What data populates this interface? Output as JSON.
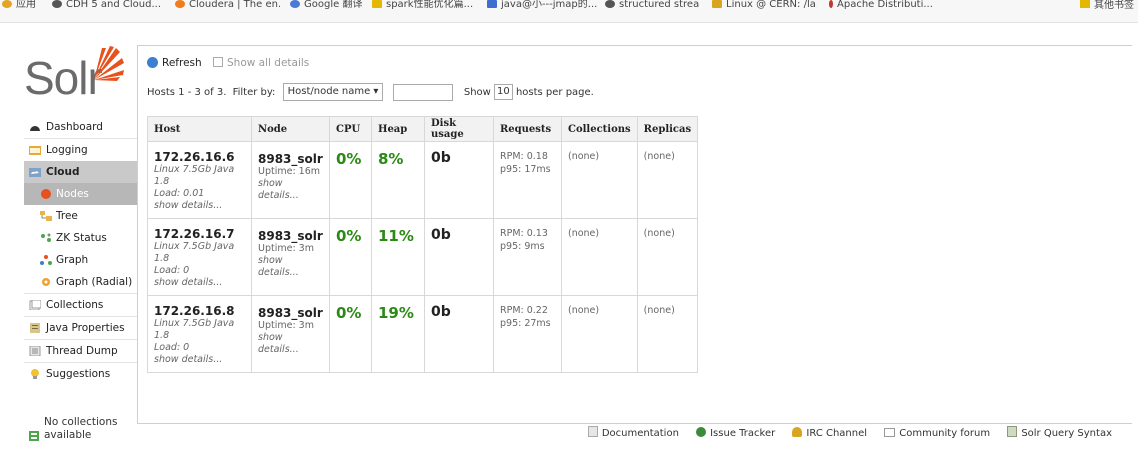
{
  "bookmarks": [
    {
      "label": "应用",
      "color": "#e4a524"
    },
    {
      "label": "CDH 5 and Cloud...",
      "color": "#555555"
    },
    {
      "label": "Cloudera | The en...",
      "color": "#f07c1c"
    },
    {
      "label": "Google 翻译",
      "color": "#4a7ad8"
    },
    {
      "label": "spark性能优化篇...",
      "color": "#e4b700"
    },
    {
      "label": "java@小---jmap的...",
      "color": "#3b6fd0"
    },
    {
      "label": "structured strea...",
      "color": "#555555"
    },
    {
      "label": "Linux @ CERN: /la...",
      "color": "#d9a520"
    },
    {
      "label": "Apache Distributi...",
      "color": "#c0392b"
    }
  ],
  "bookmarks_right": "其他书签",
  "logo_text": "Solr",
  "sidebar": {
    "items": [
      {
        "label": "Dashboard",
        "icon": "dashboard-icon"
      },
      {
        "label": "Logging",
        "icon": "logging-icon"
      },
      {
        "label": "Cloud",
        "icon": "cloud-icon"
      },
      {
        "label": "Nodes",
        "icon": "nodes-icon"
      },
      {
        "label": "Tree",
        "icon": "tree-icon"
      },
      {
        "label": "ZK Status",
        "icon": "zk-status-icon"
      },
      {
        "label": "Graph",
        "icon": "graph-icon"
      },
      {
        "label": "Graph (Radial)",
        "icon": "graph-radial-icon"
      },
      {
        "label": "Collections",
        "icon": "collections-icon"
      },
      {
        "label": "Java Properties",
        "icon": "java-properties-icon"
      },
      {
        "label": "Thread Dump",
        "icon": "thread-dump-icon"
      },
      {
        "label": "Suggestions",
        "icon": "suggestions-icon"
      }
    ],
    "no_collections_line1": "No collections",
    "no_collections_line2": "available"
  },
  "toolbar": {
    "refresh_label": "Refresh",
    "show_all_label": "Show all details"
  },
  "filter": {
    "hosts_text": "Hosts 1 - 3 of 3.",
    "filter_by": "Filter by:",
    "select_value": "Host/node name ▾",
    "search_value": "",
    "show_label": "Show",
    "per_page_value": "10",
    "per_page_suffix": "hosts per page."
  },
  "table": {
    "headers": [
      "Host",
      "Node",
      "CPU",
      "Heap",
      "Disk usage",
      "Requests",
      "Collections",
      "Replicas"
    ],
    "rows": [
      {
        "host": "172.26.16.6",
        "host_info": "Linux 7.5Gb Java 1.8",
        "load": "Load: 0.01",
        "host_details": "show details...",
        "node": "8983_solr",
        "uptime": "Uptime: 16m",
        "node_details": "show details...",
        "cpu": "0%",
        "heap": "8%",
        "disk": "0b",
        "rpm": "RPM: 0.18",
        "p95": "p95: 17ms",
        "collections": "(none)",
        "replicas": "(none)"
      },
      {
        "host": "172.26.16.7",
        "host_info": "Linux 7.5Gb Java 1.8",
        "load": "Load: 0",
        "host_details": "show details...",
        "node": "8983_solr",
        "uptime": "Uptime: 3m",
        "node_details": "show details...",
        "cpu": "0%",
        "heap": "11%",
        "disk": "0b",
        "rpm": "RPM: 0.13",
        "p95": "p95: 9ms",
        "collections": "(none)",
        "replicas": "(none)"
      },
      {
        "host": "172.26.16.8",
        "host_info": "Linux 7.5Gb Java 1.8",
        "load": "Load: 0",
        "host_details": "show details...",
        "node": "8983_solr",
        "uptime": "Uptime: 3m",
        "node_details": "show details...",
        "cpu": "0%",
        "heap": "19%",
        "disk": "0b",
        "rpm": "RPM: 0.22",
        "p95": "p95: 27ms",
        "collections": "(none)",
        "replicas": "(none)"
      }
    ]
  },
  "footer": {
    "links": [
      "Documentation",
      "Issue Tracker",
      "IRC Channel",
      "Community forum",
      "Solr Query Syntax"
    ]
  },
  "colors": {
    "metric_green": "#2b8a14",
    "logo_orange": "#e8501c"
  }
}
